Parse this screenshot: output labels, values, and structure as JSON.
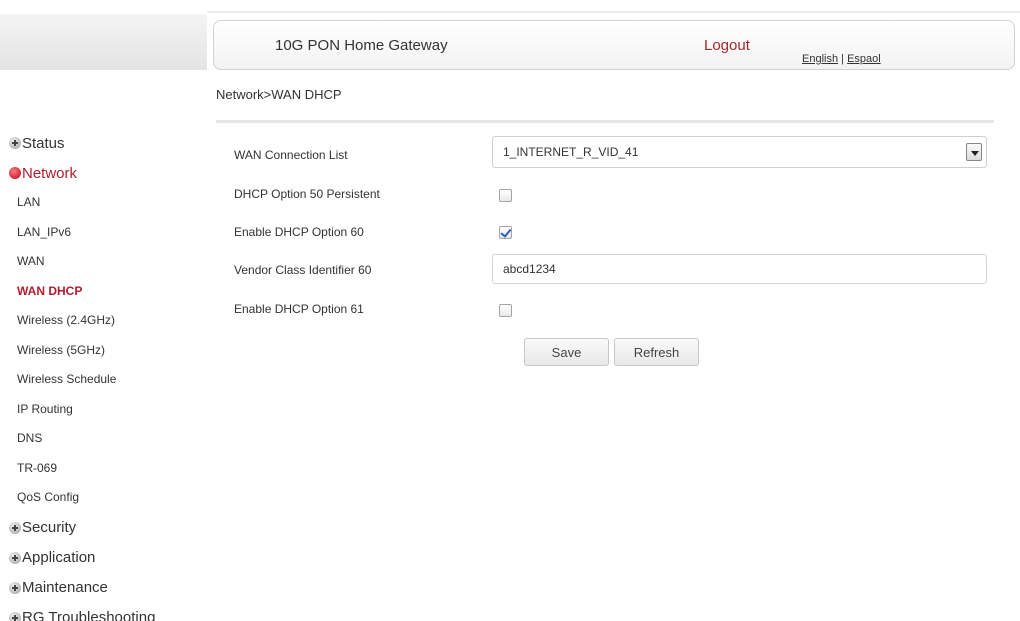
{
  "header": {
    "title": "10G PON Home Gateway",
    "logout": "Logout",
    "lang_english": "English",
    "lang_separator": "|",
    "lang_spanish": "Espaol"
  },
  "breadcrumb": "Network>WAN DHCP",
  "sidebar": {
    "sections": [
      {
        "label": "Status"
      },
      {
        "label": "Network",
        "active": true
      },
      {
        "label": "Security"
      },
      {
        "label": "Application"
      },
      {
        "label": "Maintenance"
      },
      {
        "label": "RG Troubleshooting"
      }
    ],
    "network_items": [
      "LAN",
      "LAN_IPv6",
      "WAN",
      "WAN DHCP",
      "Wireless (2.4GHz)",
      "Wireless (5GHz)",
      "Wireless Schedule",
      "IP Routing",
      "DNS",
      "TR-069",
      "QoS Config"
    ],
    "selected_item": "WAN DHCP"
  },
  "form": {
    "wan_connection_label": "WAN Connection List",
    "wan_connection_value": "1_INTERNET_R_VID_41",
    "option50_label": "DHCP Option 50 Persistent",
    "option50_checked": false,
    "option60_label": "Enable DHCP Option 60",
    "option60_checked": true,
    "vendor_class_label": "Vendor Class Identifier 60",
    "vendor_class_value": "abcd1234",
    "option61_label": "Enable DHCP Option 61",
    "option61_checked": false,
    "save_label": "Save",
    "refresh_label": "Refresh"
  },
  "colors": {
    "accent": "#b01e2d",
    "checkmark": "#2d5fbf"
  }
}
